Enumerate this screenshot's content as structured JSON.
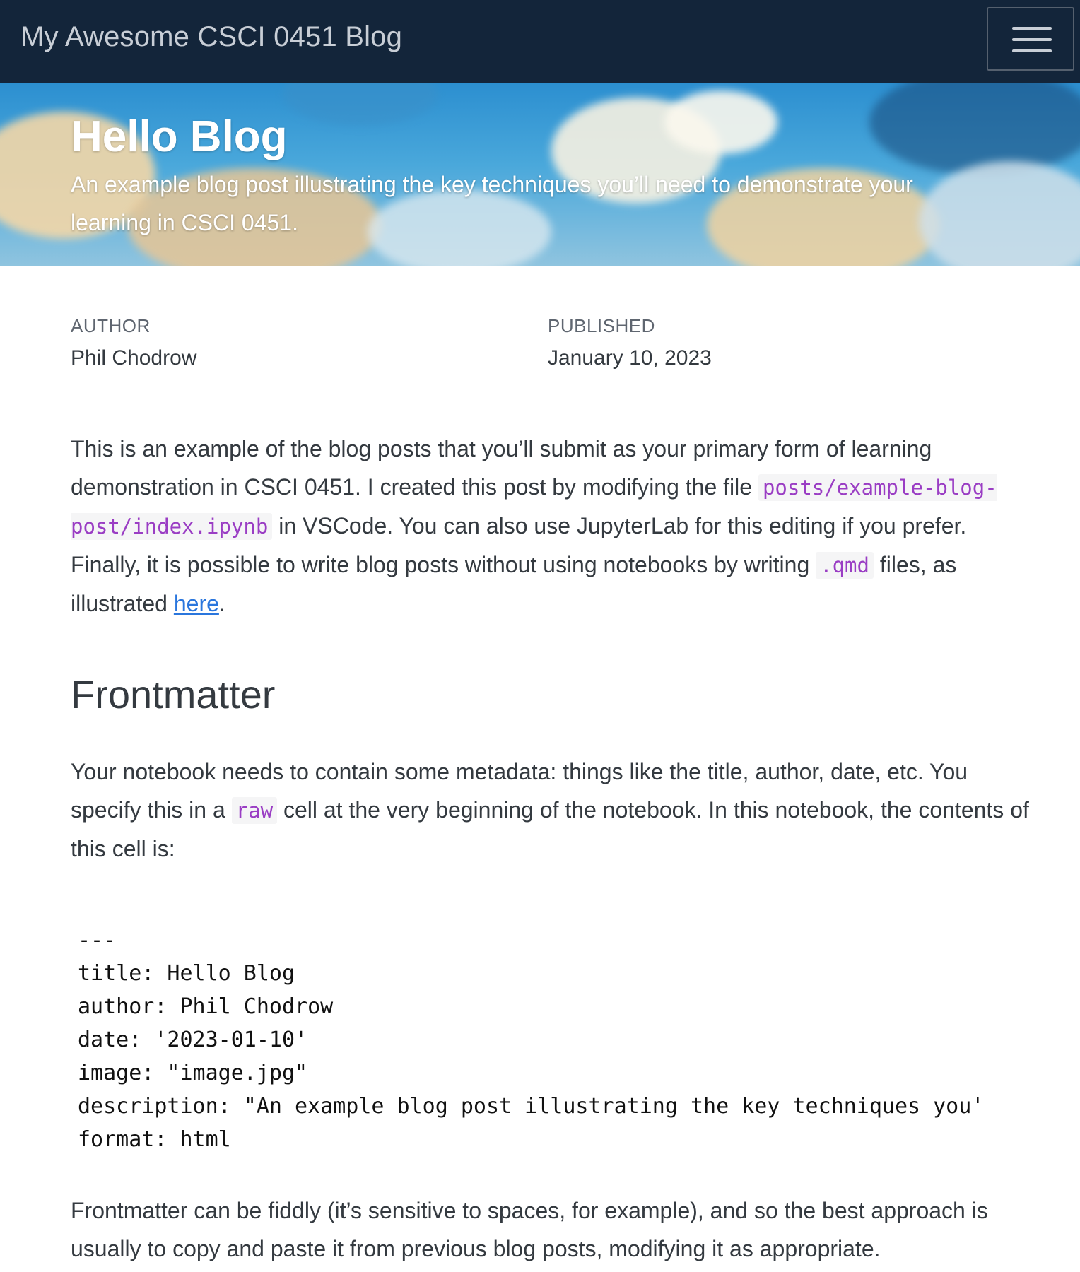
{
  "navbar": {
    "brand": "My Awesome CSCI 0451 Blog",
    "menu_icon": "hamburger-menu-icon"
  },
  "banner": {
    "title": "Hello Blog",
    "description": "An example blog post illustrating the key techniques you’ll need to demonstrate your learning in CSCI 0451."
  },
  "meta": {
    "author_label": "AUTHOR",
    "author": "Phil Chodrow",
    "published_label": "PUBLISHED",
    "published": "January 10, 2023"
  },
  "intro": {
    "text1": "This is an example of the blog posts that you’ll submit as your primary form of learning demonstration in CSCI 0451. I created this post by modifying the file ",
    "code1": "posts/example-blog-post/index.ipynb",
    "text2": " in VSCode. You can also use JupyterLab for this editing if you prefer. Finally, it is possible to write blog posts without using notebooks by writing ",
    "code2": ".qmd",
    "text3": " files, as illustrated ",
    "link": "here",
    "text4": "."
  },
  "frontmatter": {
    "heading": "Frontmatter",
    "text1": "Your notebook needs to contain some metadata: things like the title, author, date, etc. You specify this in a ",
    "code1": "raw",
    "text2": " cell at the very beginning of the notebook. In this notebook, the contents of this cell is:",
    "code_lines": [
      "---",
      "title: Hello Blog",
      "author: Phil Chodrow",
      "date: '2023-01-10'",
      "image: \"image.jpg\"",
      "description: \"An example blog post illustrating the key techniques you'",
      "format: html",
      "---"
    ],
    "after": "Frontmatter can be fiddly (it’s sensitive to spaces, for example), and so the best approach is usually to copy and paste it from previous blog posts, modifying it as appropriate."
  },
  "colors": {
    "navbar_bg": "#13253a",
    "link": "#2a76dd",
    "inline_code": "#9a3dc4",
    "text": "#343a40"
  }
}
